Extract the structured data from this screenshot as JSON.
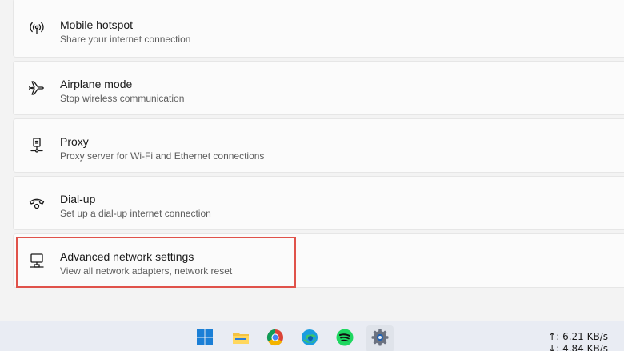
{
  "settings": {
    "items": [
      {
        "title": "Mobile hotspot",
        "desc": "Share your internet connection",
        "icon": "hotspot-icon"
      },
      {
        "title": "Airplane mode",
        "desc": "Stop wireless communication",
        "icon": "airplane-icon"
      },
      {
        "title": "Proxy",
        "desc": "Proxy server for Wi-Fi and Ethernet connections",
        "icon": "proxy-icon"
      },
      {
        "title": "Dial-up",
        "desc": "Set up a dial-up internet connection",
        "icon": "dial-up-icon"
      },
      {
        "title": "Advanced network settings",
        "desc": "View all network adapters, network reset",
        "icon": "network-adapter-icon"
      }
    ]
  },
  "taskbar": {
    "apps": [
      "start-icon",
      "file-explorer-icon",
      "chrome-icon",
      "edge-icon",
      "spotify-icon",
      "settings-icon"
    ],
    "upload_speed": "↑: 6.21 KB/s",
    "download_speed": "↓: 4.84 KB/s"
  },
  "colors": {
    "highlight": "#e0524a",
    "accent": "#0067c0"
  }
}
